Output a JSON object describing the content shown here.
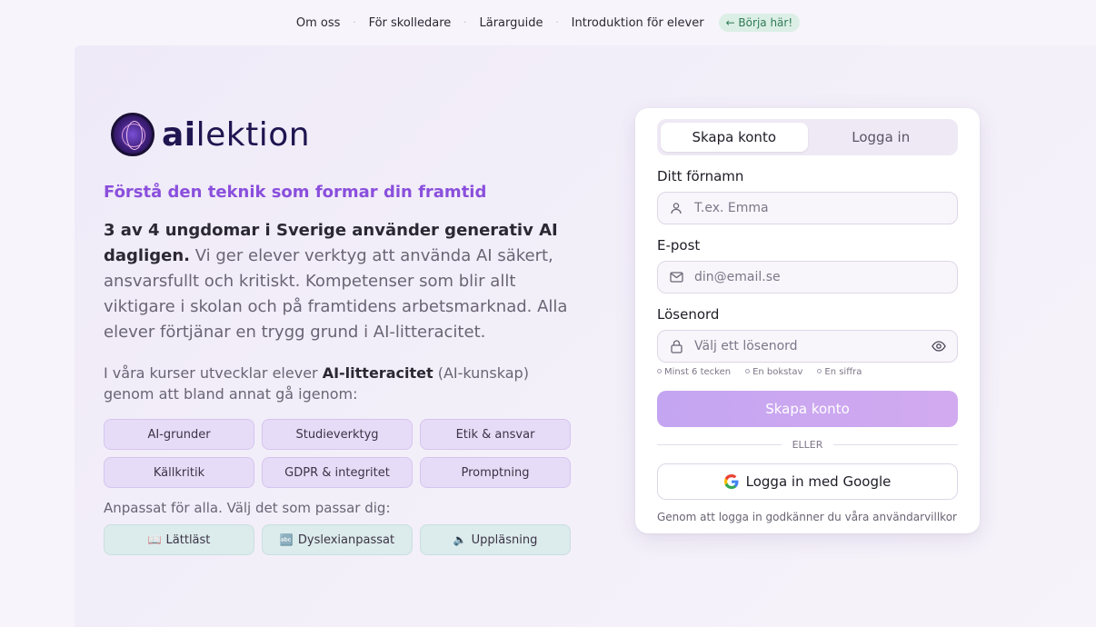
{
  "nav": {
    "items": [
      "Om oss",
      "För skolledare",
      "Lärarguide",
      "Introduktion för elever"
    ],
    "badge": "← Börja här!"
  },
  "brand": {
    "name_bold": "ai",
    "name_rest": "lektion",
    "icon": "brain-globe-logo"
  },
  "hero": {
    "headline": "Förstå den teknik som formar din framtid",
    "lead_strong": "3 av 4 ungdomar i Sverige använder generativ AI dagligen.",
    "lead_rest": " Vi ger elever verktyg att använda AI säkert, ansvarsfullt och kritiskt. Kompetenser som blir allt viktigare i skolan och på framtidens arbetsmarknad. Alla elever förtjänar en trygg grund i AI-litteracitet.",
    "courses_pre": "I våra kurser utvecklar elever ",
    "courses_strong": "AI-litteracitet",
    "courses_post": " (AI-kunskap) genom att bland annat gå igenom:"
  },
  "topics": [
    "AI-grunder",
    "Studieverktyg",
    "Etik & ansvar",
    "Källkritik",
    "GDPR & integritet",
    "Promptning"
  ],
  "adapt": {
    "label": "Anpassat för alla. Välj det som passar dig:",
    "options": [
      {
        "icon": "📖",
        "label": "Lättläst"
      },
      {
        "icon": "🔤",
        "label": "Dyslexianpassat"
      },
      {
        "icon": "🔈",
        "label": "Uppläsning"
      }
    ]
  },
  "form": {
    "tabs": [
      "Skapa konto",
      "Logga in"
    ],
    "name_label": "Ditt förnamn",
    "name_placeholder": "T.ex. Emma",
    "email_label": "E-post",
    "email_placeholder": "din@email.se",
    "password_label": "Lösenord",
    "password_placeholder": "Välj ett lösenord",
    "hints": [
      "Minst 6 tecken",
      "En bokstav",
      "En siffra"
    ],
    "submit": "Skapa konto",
    "divider": "ELLER",
    "google": "Logga in med Google",
    "terms": "Genom att logga in godkänner du våra användarvillkor"
  },
  "colors": {
    "accent": "#8a4fdc",
    "badge_bg": "#dcefe6",
    "badge_text": "#2f7a55",
    "submit_gradient": [
      "#c4a5f1",
      "#d2aaf0"
    ]
  }
}
